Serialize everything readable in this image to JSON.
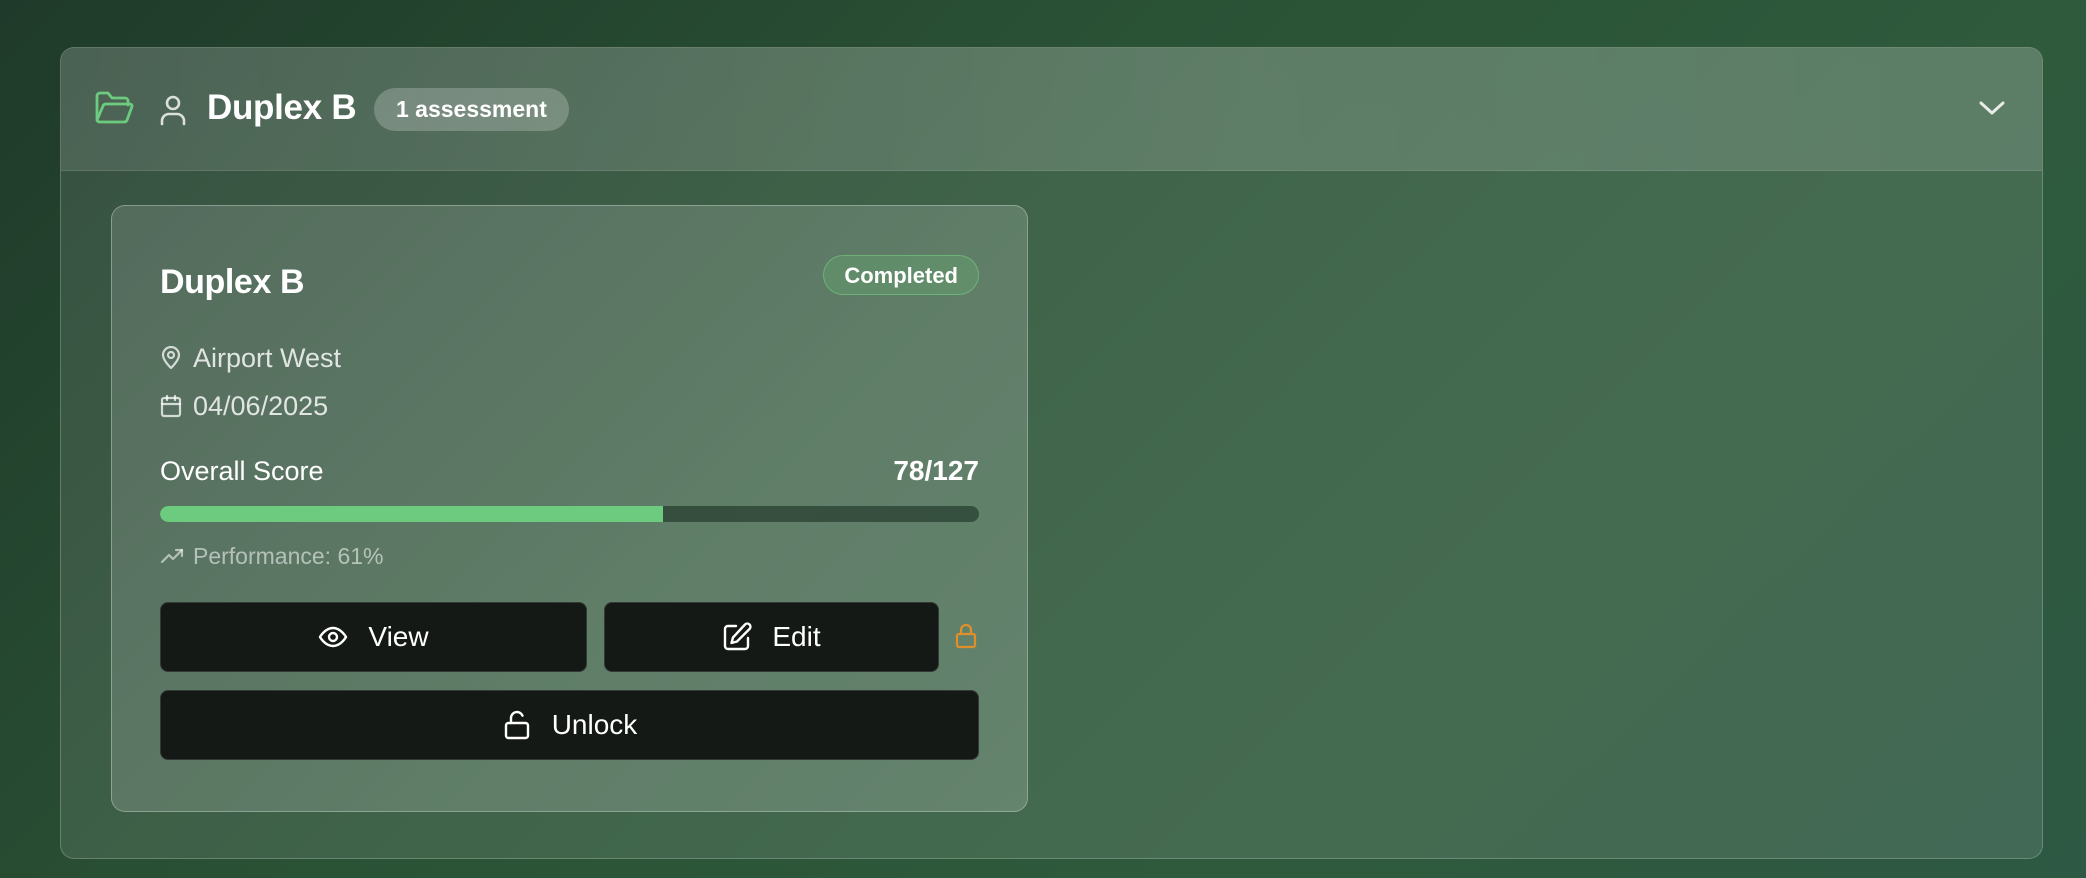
{
  "group": {
    "title": "Duplex B",
    "badge": "1 assessment",
    "icons": {
      "folder": "folder-open-icon",
      "user": "user-icon",
      "toggle": "chevron-down-icon"
    }
  },
  "card": {
    "title": "Duplex B",
    "status": "Completed",
    "location": "Airport West",
    "date": "04/06/2025",
    "score_label": "Overall Score",
    "score_value": "78/127",
    "score_fraction": 0.614,
    "performance": "Performance: 61%",
    "buttons": {
      "view": "View",
      "edit": "Edit",
      "unlock": "Unlock"
    }
  },
  "colors": {
    "accent_green": "#6ccb7e",
    "lock_orange": "#e0902a",
    "button_bg": "#141915"
  }
}
